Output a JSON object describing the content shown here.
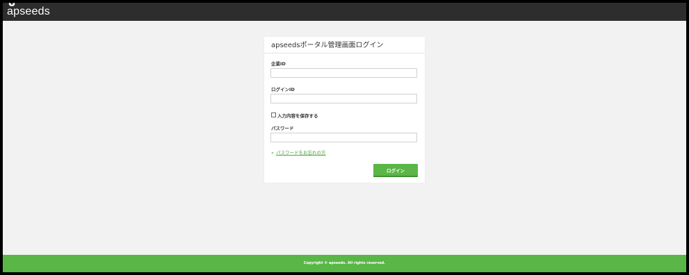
{
  "header": {
    "logo_text": "apseeds",
    "background_color": "#2d2d2d"
  },
  "login": {
    "title": "apseedsポータル管理画面ログイン",
    "company_id_label": "企業ID",
    "company_id_value": "",
    "login_id_label": "ログインID",
    "login_id_value": "",
    "remember_label": "入力内容を保存する",
    "remember_checked": false,
    "password_label": "パスワード",
    "password_value": "",
    "forgot_chevron": "»",
    "forgot_link": "パスワードをお忘れの方",
    "submit_label": "ログイン"
  },
  "footer": {
    "copyright": "Copyright © apseeds. All rights reserved.",
    "background_color": "#5ab647"
  },
  "colors": {
    "accent": "#5ab647",
    "page_background": "#f2f2f2"
  }
}
